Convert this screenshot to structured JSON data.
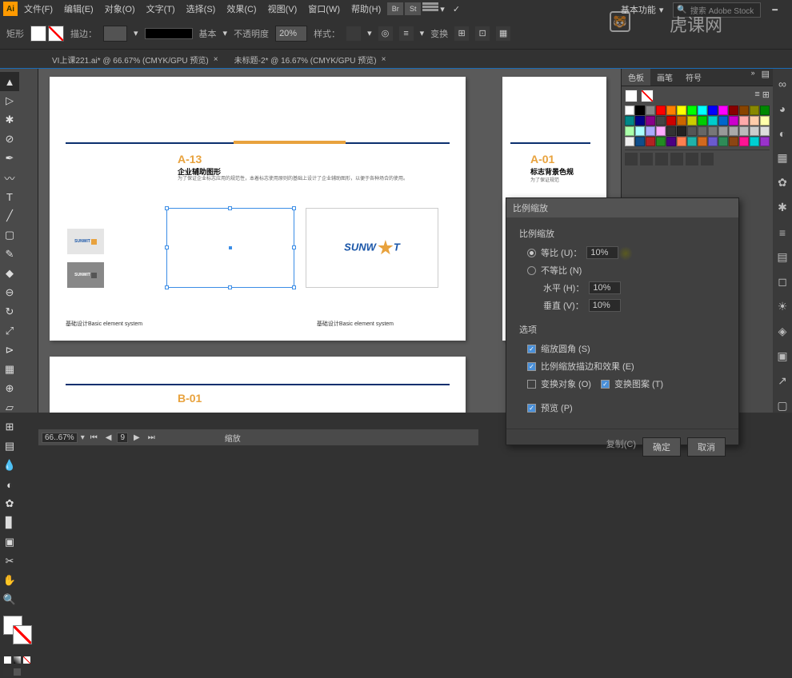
{
  "menubar": {
    "app": "Ai",
    "items": [
      "文件(F)",
      "编辑(E)",
      "对象(O)",
      "文字(T)",
      "选择(S)",
      "效果(C)",
      "视图(V)",
      "窗口(W)",
      "帮助(H)"
    ],
    "right_badges": [
      "Br",
      "St"
    ],
    "basic_label": "基本功能",
    "search_placeholder": "搜索 Adobe Stock"
  },
  "controlbar": {
    "shape": "矩形",
    "stroke_label": "描边：",
    "stroke_pt": "",
    "style_label": "基本",
    "opacity_label": "不透明度",
    "opacity_value": "20%",
    "pref_label": "样式：",
    "transform_label": "变换"
  },
  "tabs": {
    "t1": "VI上课221.ai* @ 66.67% (CMYK/GPU 预览)",
    "t2": "未标题-2* @ 16.67% (CMYK/GPU 预览)"
  },
  "artboard": {
    "code": "A-13",
    "title": "企业辅助图形",
    "desc": "为了保证企业标志应用的规范性，本着标志使用原则的基础上设计了企业辅助图形，以便于各种场合的使用。",
    "footer": "基础设计Basic element system",
    "logo_text": "SUNW",
    "logo_text2": "T",
    "thumb_logo": "SUNWIT"
  },
  "artboard2": {
    "code": "A-01",
    "title": "标志背景色规",
    "desc": "为了保证规范"
  },
  "artboard_b": {
    "code": "B-01"
  },
  "swatches_panel": {
    "tabs": [
      "色板",
      "画笔",
      "符号"
    ]
  },
  "dialog": {
    "title": "比例缩放",
    "section": "比例缩放",
    "uniform": "等比 (U)：",
    "uniform_val": "10%",
    "nonuniform": "不等比 (N)",
    "horiz": "水平 (H)：",
    "horiz_val": "10%",
    "vert": "垂直 (V)：",
    "vert_val": "10%",
    "options": "选项",
    "corners": "缩放圆角 (S)",
    "effects": "比例缩放描边和效果 (E)",
    "trans_obj": "变换对象 (O)",
    "trans_pat": "变换图案 (T)",
    "preview": "预览 (P)",
    "copy": "复制(C)",
    "ok": "确定",
    "cancel": "取消"
  },
  "statusbar": {
    "zoom": "66..67%",
    "page": "9",
    "tool": "缩放"
  },
  "watermark": "虎课网"
}
